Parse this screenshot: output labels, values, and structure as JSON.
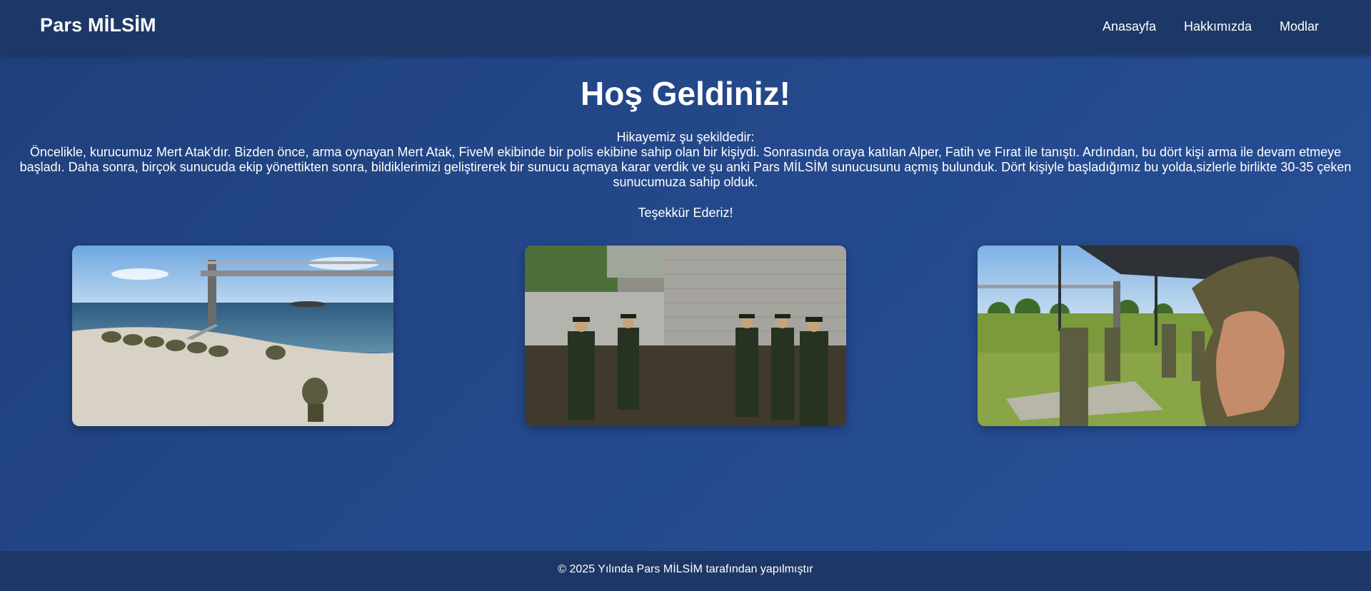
{
  "header": {
    "brand": "Pars MİLSİM",
    "nav": [
      "Anasayfa",
      "Hakkımızda",
      "Modlar"
    ]
  },
  "main": {
    "title": "Hoş Geldiniz!",
    "story_intro": "Hikayemiz şu şekildedir:",
    "story_body": "Öncelikle, kurucumuz Mert Atak'dır. Bizden önce, arma oynayan Mert Atak, FiveM ekibinde bir polis ekibine sahip olan bir kişiydi. Sonrasında oraya katılan Alper, Fatih ve Fırat ile tanıştı. Ardından, bu dört kişi arma ile devam etmeye başladı. Daha sonra, birçok sunucuda ekip yönettikten sonra, bildiklerimizi geliştirerek bir sunucu açmaya karar verdik ve şu anki Pars MİLSİM sunucusunu açmış bulunduk. Dört kişiyle başladığımız bu yolda,sizlerle birlikte 30-35 çeken sunucumuza sahip olduk.",
    "thanks": "Teşekkür Ederiz!",
    "gallery": [
      "beach-training-photo",
      "officers-ceremony-photo",
      "shooting-range-photo"
    ]
  },
  "footer": {
    "text": "© 2025 Yılında Pars MİLSİM tarafından yapılmıştır"
  },
  "colors": {
    "navbar": "#1d3766",
    "background": "#24498c",
    "text": "#ffffff"
  }
}
